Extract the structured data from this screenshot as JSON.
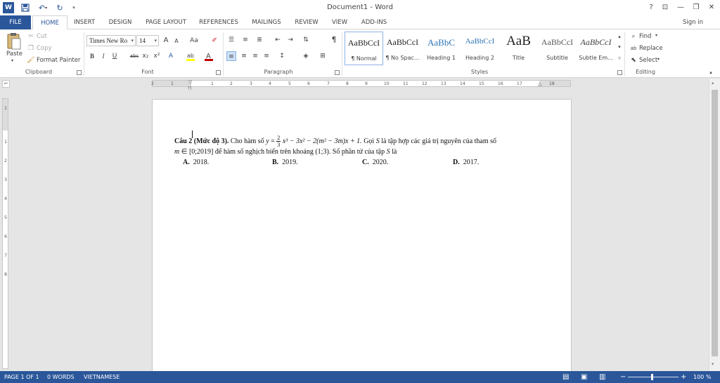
{
  "title_bar": {
    "title": "Document1 - Word",
    "help": "?",
    "minimize": "—",
    "restore": "❐",
    "close": "✕",
    "ribbon_opts": "⊡"
  },
  "tabs": [
    "FILE",
    "HOME",
    "INSERT",
    "DESIGN",
    "PAGE LAYOUT",
    "REFERENCES",
    "MAILINGS",
    "REVIEW",
    "VIEW",
    "ADD-INS"
  ],
  "sign_in": "Sign in",
  "clipboard": {
    "paste": "Paste",
    "cut": "Cut",
    "copy": "Copy",
    "format_painter": "Format Painter",
    "label": "Clipboard"
  },
  "font": {
    "name": "Times New Ro",
    "size": "14",
    "label": "Font",
    "bold": "B",
    "italic": "I",
    "underline": "U",
    "strike": "abc",
    "sub": "x₂",
    "sup": "x²",
    "grow": "A",
    "shrink": "A",
    "case": "Aa"
  },
  "paragraph": {
    "label": "Paragraph",
    "pilcrow": "¶"
  },
  "styles": {
    "label": "Styles",
    "items": [
      {
        "preview": "AaBbCcI",
        "name": "¶ Normal"
      },
      {
        "preview": "AaBbCcI",
        "name": "¶ No Spac..."
      },
      {
        "preview": "AaBbC",
        "name": "Heading 1"
      },
      {
        "preview": "AaBbCcI",
        "name": "Heading 2"
      },
      {
        "preview": "AaB",
        "name": "Title"
      },
      {
        "preview": "AaBbCcI",
        "name": "Subtitle"
      },
      {
        "preview": "AaBbCcI",
        "name": "Subtle Em..."
      }
    ],
    "colors": {
      "heading": "#2e74b5",
      "normal": "#222222"
    }
  },
  "editing": {
    "find": "Find",
    "replace": "Replace",
    "select": "Select",
    "label": "Editing"
  },
  "ruler_h": [
    "2",
    "1",
    "1",
    "2",
    "3",
    "4",
    "5",
    "6",
    "7",
    "8",
    "9",
    "10",
    "11",
    "12",
    "13",
    "14",
    "15",
    "16",
    "17",
    "18"
  ],
  "ruler_v": [
    "1",
    "1",
    "2",
    "3",
    "4",
    "5",
    "6",
    "7",
    "8"
  ],
  "document": {
    "q_label": "Câu 2",
    "q_level": "(Mức độ 3).",
    "q_text1": "Cho hàm số",
    "q_var_y": "y",
    "q_eq": "=",
    "frac_num": "2",
    "frac_den": "3",
    "q_math": "x³ − 3x² − 2(m² − 3m)x + 1.",
    "q_text2": "Gọi",
    "q_var_s": "S",
    "q_text3": "là tập hợp các giá trị nguyên của tham số",
    "q_var_m": "m",
    "q_line2": "∈ [0;2019] để hàm số nghịch biến trên khoảng (1;3). Số phần tử của tập",
    "q_line2_var": "S",
    "q_line2_end": "là",
    "answers": [
      {
        "label": "A.",
        "value": "2018."
      },
      {
        "label": "B.",
        "value": "2019."
      },
      {
        "label": "C.",
        "value": "2020."
      },
      {
        "label": "D.",
        "value": "2017."
      }
    ]
  },
  "status": {
    "page": "PAGE 1 OF 1",
    "words": "0 WORDS",
    "lang": "VIETNAMESE",
    "zoom": "100 %",
    "minus": "−",
    "plus": "+"
  },
  "colors": {
    "brand": "#2b579a",
    "ribbon_bg": "#ffffff",
    "workspace": "#e5e5e5"
  }
}
